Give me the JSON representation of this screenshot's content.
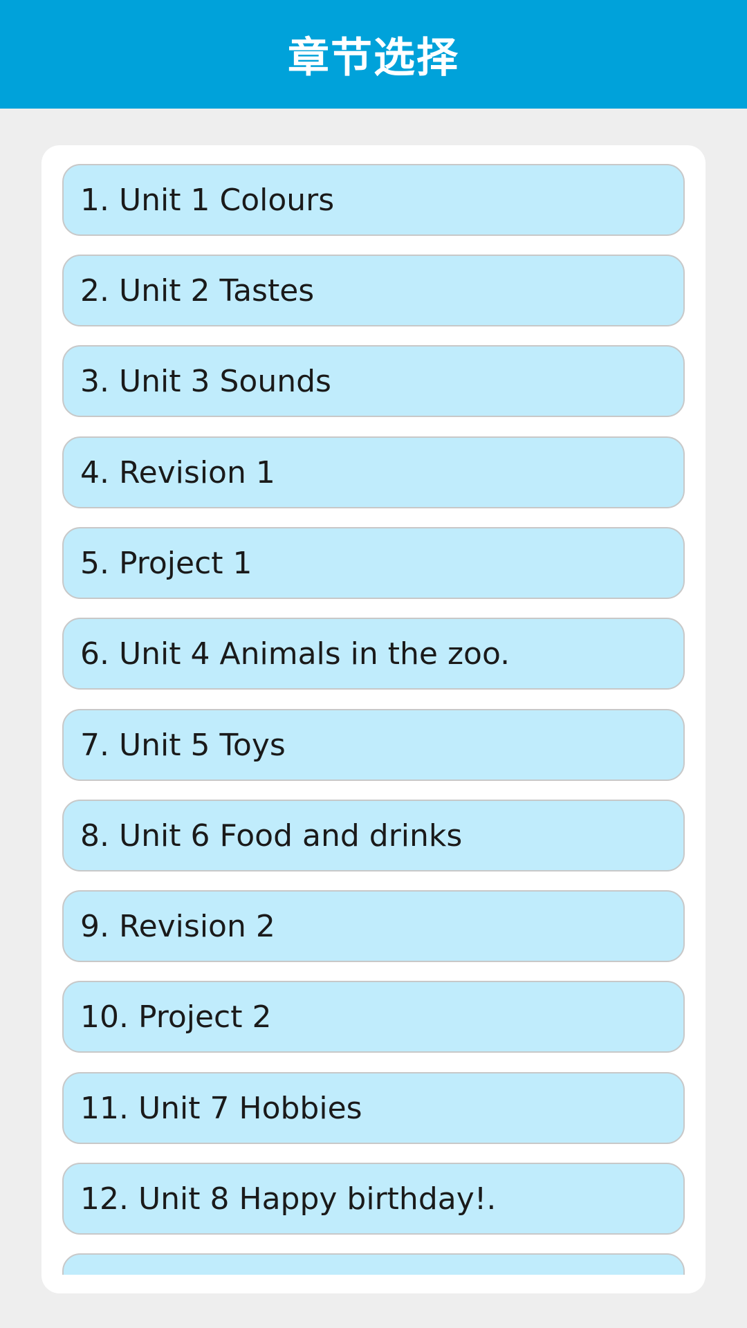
{
  "header": {
    "title": "章节选择"
  },
  "colors": {
    "header": "#00a2da",
    "item_bg": "#c0ecfc",
    "background": "#eeeeee"
  },
  "chapters": [
    {
      "label": "1. Unit 1 Colours"
    },
    {
      "label": "2. Unit 2 Tastes"
    },
    {
      "label": "3. Unit 3 Sounds"
    },
    {
      "label": "4. Revision 1"
    },
    {
      "label": "5. Project 1"
    },
    {
      "label": "6. Unit 4 Animals in the zoo."
    },
    {
      "label": "7. Unit 5 Toys"
    },
    {
      "label": "8. Unit 6 Food and drinks"
    },
    {
      "label": "9. Revision 2"
    },
    {
      "label": "10. Project 2"
    },
    {
      "label": "11. Unit 7 Hobbies"
    },
    {
      "label": "12. Unit 8 Happy birthday!."
    }
  ]
}
